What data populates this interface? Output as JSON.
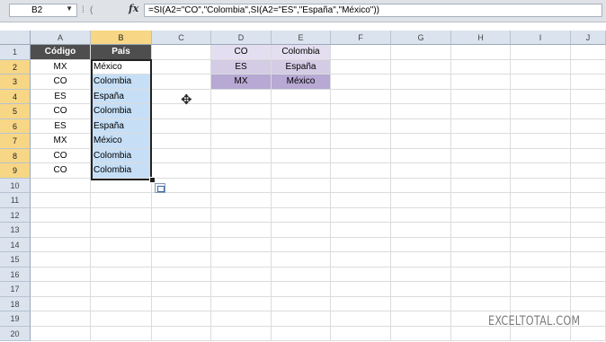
{
  "formula_bar": {
    "name_box": "B2",
    "fx": "fx",
    "formula": "=SI(A2=\"CO\",\"Colombia\",SI(A2=\"ES\",\"España\",\"México\"))"
  },
  "columns": [
    "A",
    "B",
    "C",
    "D",
    "E",
    "F",
    "G",
    "H",
    "I",
    "J"
  ],
  "rows": [
    "1",
    "2",
    "3",
    "4",
    "5",
    "6",
    "7",
    "8",
    "9",
    "10",
    "11",
    "12",
    "13",
    "14",
    "15",
    "16",
    "17",
    "18",
    "19",
    "20"
  ],
  "table": {
    "headers": [
      "Código",
      "País"
    ],
    "codes": [
      "MX",
      "CO",
      "ES",
      "CO",
      "ES",
      "MX",
      "CO",
      "CO"
    ],
    "countries": [
      "México",
      "Colombia",
      "España",
      "Colombia",
      "España",
      "México",
      "Colombia",
      "Colombia"
    ]
  },
  "lookup": [
    {
      "code": "CO",
      "country": "Colombia"
    },
    {
      "code": "ES",
      "country": "España"
    },
    {
      "code": "MX",
      "country": "México"
    }
  ],
  "watermark": "EXCELTOTAL.COM",
  "colors": {
    "header": "#4e4e4e",
    "selection": "#c6dff7",
    "lookup_co": "#e4dff0",
    "lookup_es": "#d4cbe5",
    "lookup_mx": "#b7a8d4"
  }
}
